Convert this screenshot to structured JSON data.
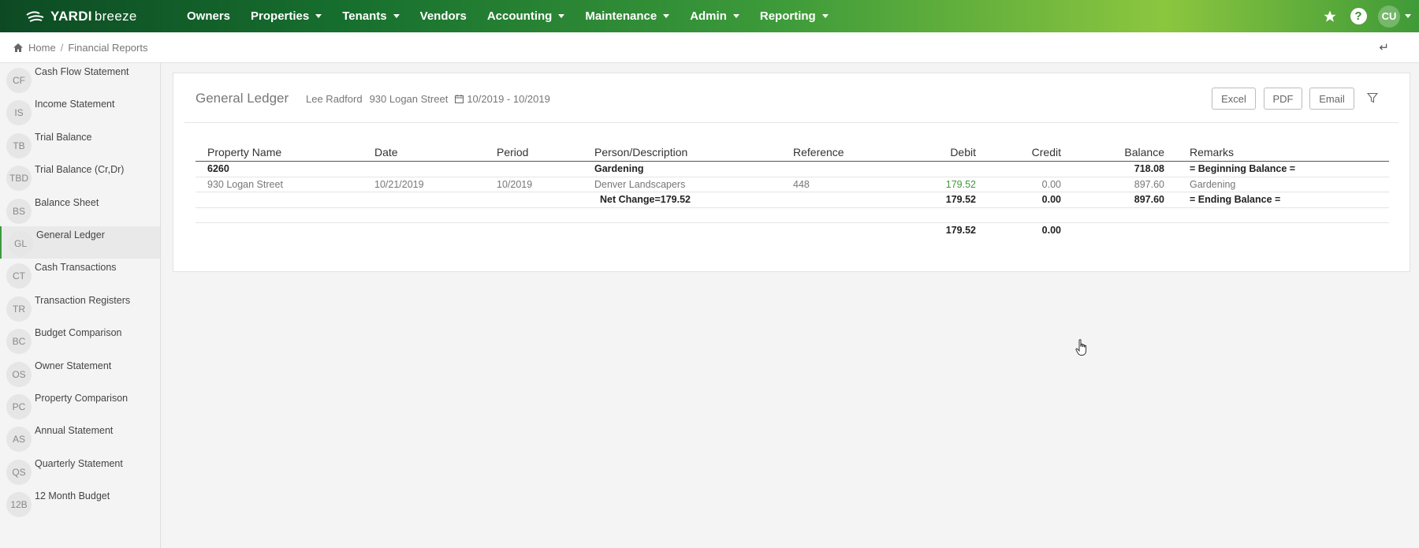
{
  "nav": {
    "logo": {
      "brand": "YARDI",
      "product": "breeze"
    },
    "items": [
      {
        "label": "Owners",
        "dropdown": false
      },
      {
        "label": "Properties",
        "dropdown": true
      },
      {
        "label": "Tenants",
        "dropdown": true
      },
      {
        "label": "Vendors",
        "dropdown": false
      },
      {
        "label": "Accounting",
        "dropdown": true
      },
      {
        "label": "Maintenance",
        "dropdown": true
      },
      {
        "label": "Admin",
        "dropdown": true
      },
      {
        "label": "Reporting",
        "dropdown": true
      }
    ],
    "right": {
      "star_icon": "star-icon",
      "help_icon": "help-icon",
      "help_glyph": "?",
      "user_initials": "CU"
    }
  },
  "breadcrumb": {
    "home": "Home",
    "current": "Financial Reports"
  },
  "sidebar": {
    "items": [
      {
        "abbr": "CF",
        "label": "Cash Flow Statement"
      },
      {
        "abbr": "IS",
        "label": "Income Statement"
      },
      {
        "abbr": "TB",
        "label": "Trial Balance"
      },
      {
        "abbr": "TBD",
        "label": "Trial Balance (Cr,Dr)"
      },
      {
        "abbr": "BS",
        "label": "Balance Sheet"
      },
      {
        "abbr": "GL",
        "label": "General Ledger"
      },
      {
        "abbr": "CT",
        "label": "Cash Transactions"
      },
      {
        "abbr": "TR",
        "label": "Transaction Registers"
      },
      {
        "abbr": "BC",
        "label": "Budget Comparison"
      },
      {
        "abbr": "OS",
        "label": "Owner Statement"
      },
      {
        "abbr": "PC",
        "label": "Property Comparison"
      },
      {
        "abbr": "AS",
        "label": "Annual Statement"
      },
      {
        "abbr": "QS",
        "label": "Quarterly Statement"
      },
      {
        "abbr": "12B",
        "label": "12 Month Budget"
      }
    ],
    "active": "General Ledger"
  },
  "report": {
    "title": "General Ledger",
    "owner": "Lee Radford",
    "property": "930 Logan Street",
    "date_range": "10/2019 - 10/2019",
    "buttons": {
      "excel": "Excel",
      "pdf": "PDF",
      "email": "Email"
    },
    "columns": {
      "property_name": "Property Name",
      "date": "Date",
      "period": "Period",
      "person_description": "Person/Description",
      "reference": "Reference",
      "debit": "Debit",
      "credit": "Credit",
      "balance": "Balance",
      "remarks": "Remarks"
    },
    "account_row": {
      "account": "6260",
      "description": "Gardening",
      "balance": "718.08",
      "remarks": "= Beginning Balance ="
    },
    "detail_row": {
      "property": "930 Logan Street",
      "date": "10/21/2019",
      "period": "10/2019",
      "description": "Denver Landscapers",
      "reference": "448",
      "debit": "179.52",
      "credit": "0.00",
      "balance": "897.60",
      "remarks": "Gardening"
    },
    "net_row": {
      "label": "Net Change=179.52",
      "debit": "179.52",
      "credit": "0.00",
      "balance": "897.60",
      "remarks": "= Ending Balance ="
    },
    "totals_row": {
      "debit": "179.52",
      "credit": "0.00"
    }
  }
}
